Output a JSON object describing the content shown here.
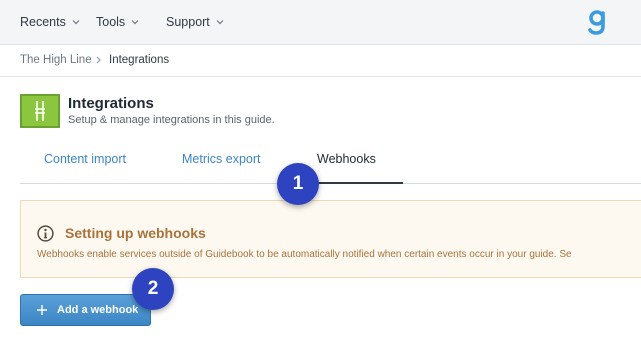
{
  "topbar": {
    "menus": [
      {
        "label": "Recents",
        "icon": "chevron-down-icon"
      },
      {
        "label": "Tools",
        "icon": "chevron-down-icon"
      },
      {
        "label": "Support",
        "icon": "chevron-down-icon"
      }
    ],
    "logo": "guidebook-logo"
  },
  "breadcrumb": {
    "items": [
      "The High Line",
      "Integrations"
    ],
    "separator": "chevron-right-icon"
  },
  "header": {
    "icon": "high-line-app-icon",
    "title": "Integrations",
    "subtitle": "Setup & manage integrations in this guide."
  },
  "tabs": [
    {
      "label": "Content import",
      "active": false
    },
    {
      "label": "Metrics export",
      "active": false
    },
    {
      "label": "Webhooks",
      "active": true
    }
  ],
  "callout": {
    "icon": "info-icon",
    "title": "Setting up webhooks",
    "body": "Webhooks enable services outside of Guidebook to be automatically notified when certain events occur in your guide. Se"
  },
  "actions": {
    "add_webhook_label": "Add a webhook",
    "add_icon": "plus-icon"
  },
  "annotations": [
    {
      "number": "1"
    },
    {
      "number": "2"
    }
  ],
  "colors": {
    "accent": "#3b86c7",
    "button": "#4a93cf",
    "badge": "#2d43bf",
    "callout_text": "#a8733b",
    "app_icon": "#8cc63f"
  }
}
